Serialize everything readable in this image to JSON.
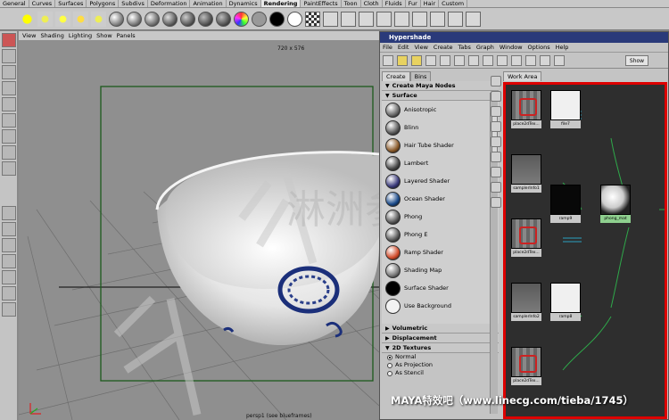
{
  "shelf": {
    "tabs": [
      "General",
      "Curves",
      "Surfaces",
      "Polygons",
      "Subdivs",
      "Deformation",
      "Animation",
      "Dynamics",
      "Rendering",
      "PaintEffects",
      "Toon",
      "Cloth",
      "Fluids",
      "Fur",
      "Hair",
      "Custom"
    ],
    "active_tab": "Rendering"
  },
  "viewport": {
    "menu": [
      "View",
      "Shading",
      "Lighting",
      "Show",
      "Panels"
    ],
    "resolution": "720 x 576",
    "camera_label": "persp1 (see blueframes)",
    "watermark_text": "淋洲参"
  },
  "hypershade": {
    "title": "Hypershade",
    "menu": [
      "File",
      "Edit",
      "View",
      "Create",
      "Tabs",
      "Graph",
      "Window",
      "Options",
      "Help"
    ],
    "show_button": "Show",
    "left_tabs": [
      "Create",
      "Bins"
    ],
    "create_header": "Create Maya Nodes",
    "section_surface": "Surface",
    "shaders": [
      {
        "label": "Anisotropic",
        "color": "#6a6a6a"
      },
      {
        "label": "Blinn",
        "color": "#5a5a5a"
      },
      {
        "label": "Hair Tube Shader",
        "color": "#8a5a2a"
      },
      {
        "label": "Lambert",
        "color": "#4a4a4a"
      },
      {
        "label": "Layered Shader",
        "color": "#3a3a7a"
      },
      {
        "label": "Ocean Shader",
        "color": "#1a4a8a"
      },
      {
        "label": "Phong",
        "color": "#5a5a5a"
      },
      {
        "label": "Phong E",
        "color": "#5a5a5a"
      },
      {
        "label": "Ramp Shader",
        "color": "#d04a2a"
      },
      {
        "label": "Shading Map",
        "color": "#7a7a7a"
      },
      {
        "label": "Surface Shader",
        "color": "#000000"
      },
      {
        "label": "Use Background",
        "color": "#eeeeee"
      }
    ],
    "section_volumetric": "Volumetric",
    "section_displacement": "Displacement",
    "section_2d": "2D Textures",
    "radio_options": [
      "Normal",
      "As Projection",
      "As Stencil"
    ],
    "radio_selected": "Normal",
    "work_tab": "Work Area",
    "nodes": [
      {
        "label": "place2dTex...",
        "kind": "place"
      },
      {
        "label": "file7",
        "kind": "white"
      },
      {
        "label": "samplerInfo1",
        "kind": "info"
      },
      {
        "label": "ramp9",
        "kind": "black"
      },
      {
        "label": "phong_mat",
        "kind": "sphere"
      },
      {
        "label": "place2dTex...",
        "kind": "place"
      },
      {
        "label": "samplerInfo2",
        "kind": "info"
      },
      {
        "label": "ramp8",
        "kind": "white"
      },
      {
        "label": "place2dTex...",
        "kind": "place"
      }
    ]
  },
  "watermark": "MAYA特效吧（www.linecg.com/tieba/1745）",
  "colors": {
    "accent_title": "#2a3a7a",
    "highlight_border": "#dd0000"
  }
}
